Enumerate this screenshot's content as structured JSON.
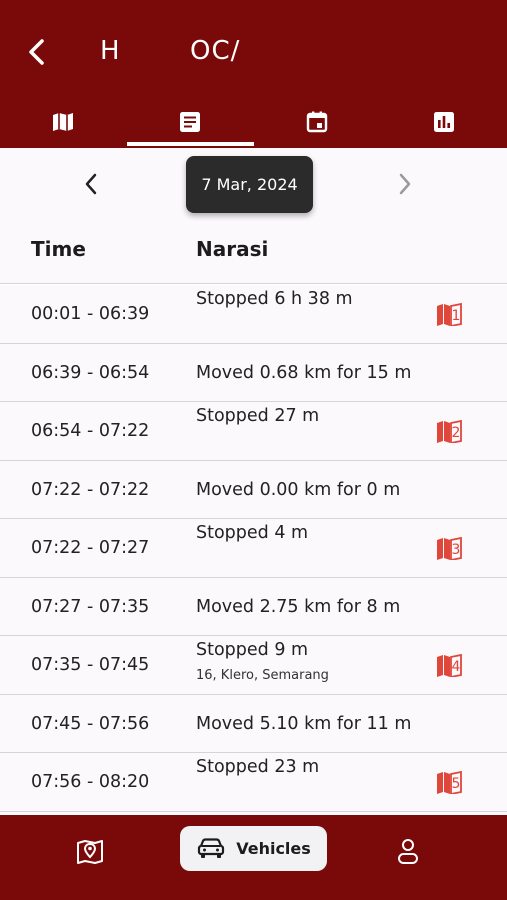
{
  "header": {
    "title_part1": "H",
    "title_part2": "OC/"
  },
  "tabs": [
    {
      "icon": "map-icon",
      "active": false
    },
    {
      "icon": "document-icon",
      "active": true
    },
    {
      "icon": "calendar-icon",
      "active": false
    },
    {
      "icon": "bar-chart-icon",
      "active": false
    }
  ],
  "date": "7 Mar, 2024",
  "columns": {
    "time": "Time",
    "narration": "Narasi"
  },
  "rows": [
    {
      "time": "00:01 - 06:39",
      "narration": "Stopped 6 h 38 m",
      "address": "",
      "flag": "1"
    },
    {
      "time": "06:39 - 06:54",
      "narration": "Moved 0.68 km for 15 m"
    },
    {
      "time": "06:54 - 07:22",
      "narration": "Stopped 27 m",
      "address": "",
      "flag": "2"
    },
    {
      "time": "07:22 - 07:22",
      "narration": "Moved 0.00 km for 0 m"
    },
    {
      "time": "07:22 - 07:27",
      "narration": "Stopped 4 m",
      "address": "",
      "flag": "3"
    },
    {
      "time": "07:27 - 07:35",
      "narration": "Moved 2.75 km for 8 m"
    },
    {
      "time": "07:35 - 07:45",
      "narration": "Stopped 9 m",
      "address": "16, Klero, Semarang",
      "flag": "4"
    },
    {
      "time": "07:45 - 07:56",
      "narration": "Moved 5.10 km for 11 m"
    },
    {
      "time": "07:56 - 08:20",
      "narration": "Stopped 23 m",
      "address": "",
      "flag": "5"
    }
  ],
  "bottom_nav": {
    "vehicles_label": "Vehicles"
  },
  "colors": {
    "brand": "#7a0a0a",
    "flag": "#e0473b"
  }
}
